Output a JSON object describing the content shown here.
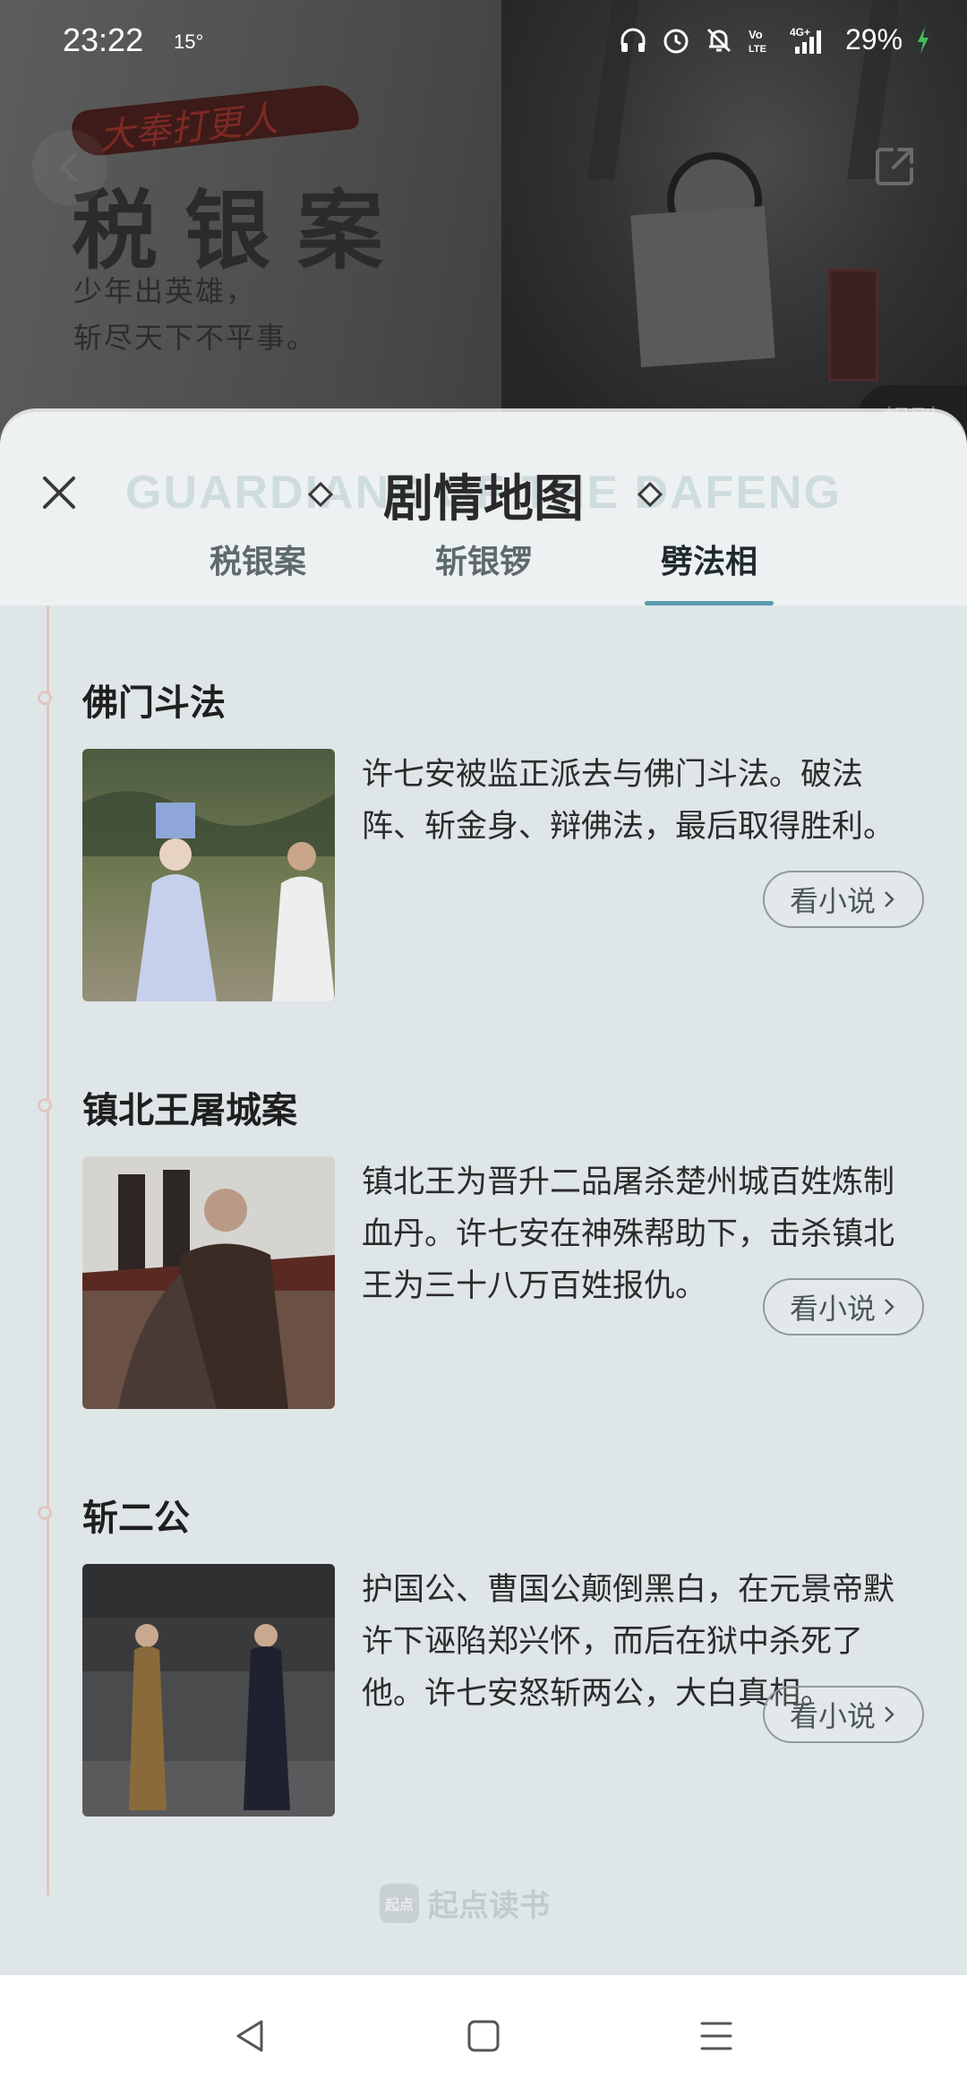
{
  "status_bar": {
    "time": "23:22",
    "temperature": "15°",
    "battery": "29%",
    "icons": [
      "headphones-icon",
      "alarm-icon",
      "mute-icon",
      "volte-icon",
      "signal-4g-icon",
      "battery-charging-icon"
    ]
  },
  "banner": {
    "brush_text": "大奉打更人",
    "title": "税银案",
    "subtitle_line1": "少年出英雄，",
    "subtitle_line2": "斩尽天下不平事。",
    "rule_tab": "规则"
  },
  "sheet": {
    "bg_title": "GUARDIANS OF THE DAFENG",
    "title": "剧情地图",
    "tabs": [
      {
        "label": "税银案",
        "active": false
      },
      {
        "label": "斩银锣",
        "active": false
      },
      {
        "label": "劈法相",
        "active": true
      }
    ],
    "episodes": [
      {
        "title": "佛门斗法",
        "description": "许七安被监正派去与佛门斗法。破法阵、斩金身、辩佛法，最后取得胜利。",
        "button": "看小说"
      },
      {
        "title": "镇北王屠城案",
        "description": "镇北王为晋升二品屠杀楚州城百姓炼制血丹。许七安在神殊帮助下，击杀镇北王为三十八万百姓报仇。",
        "button": "看小说"
      },
      {
        "title": "斩二公",
        "description": "护国公、曹国公颠倒黑白，在元景帝默许下诬陷郑兴怀，而后在狱中杀死了他。许七安怒斩两公，大白真相。",
        "button": "看小说"
      }
    ],
    "logo_mark": "起点",
    "logo_text": "起点读书"
  },
  "colors": {
    "accent": "#5c9cae",
    "timeline": "#e2c6bf",
    "sheet_bg": "#dfe6e8"
  }
}
